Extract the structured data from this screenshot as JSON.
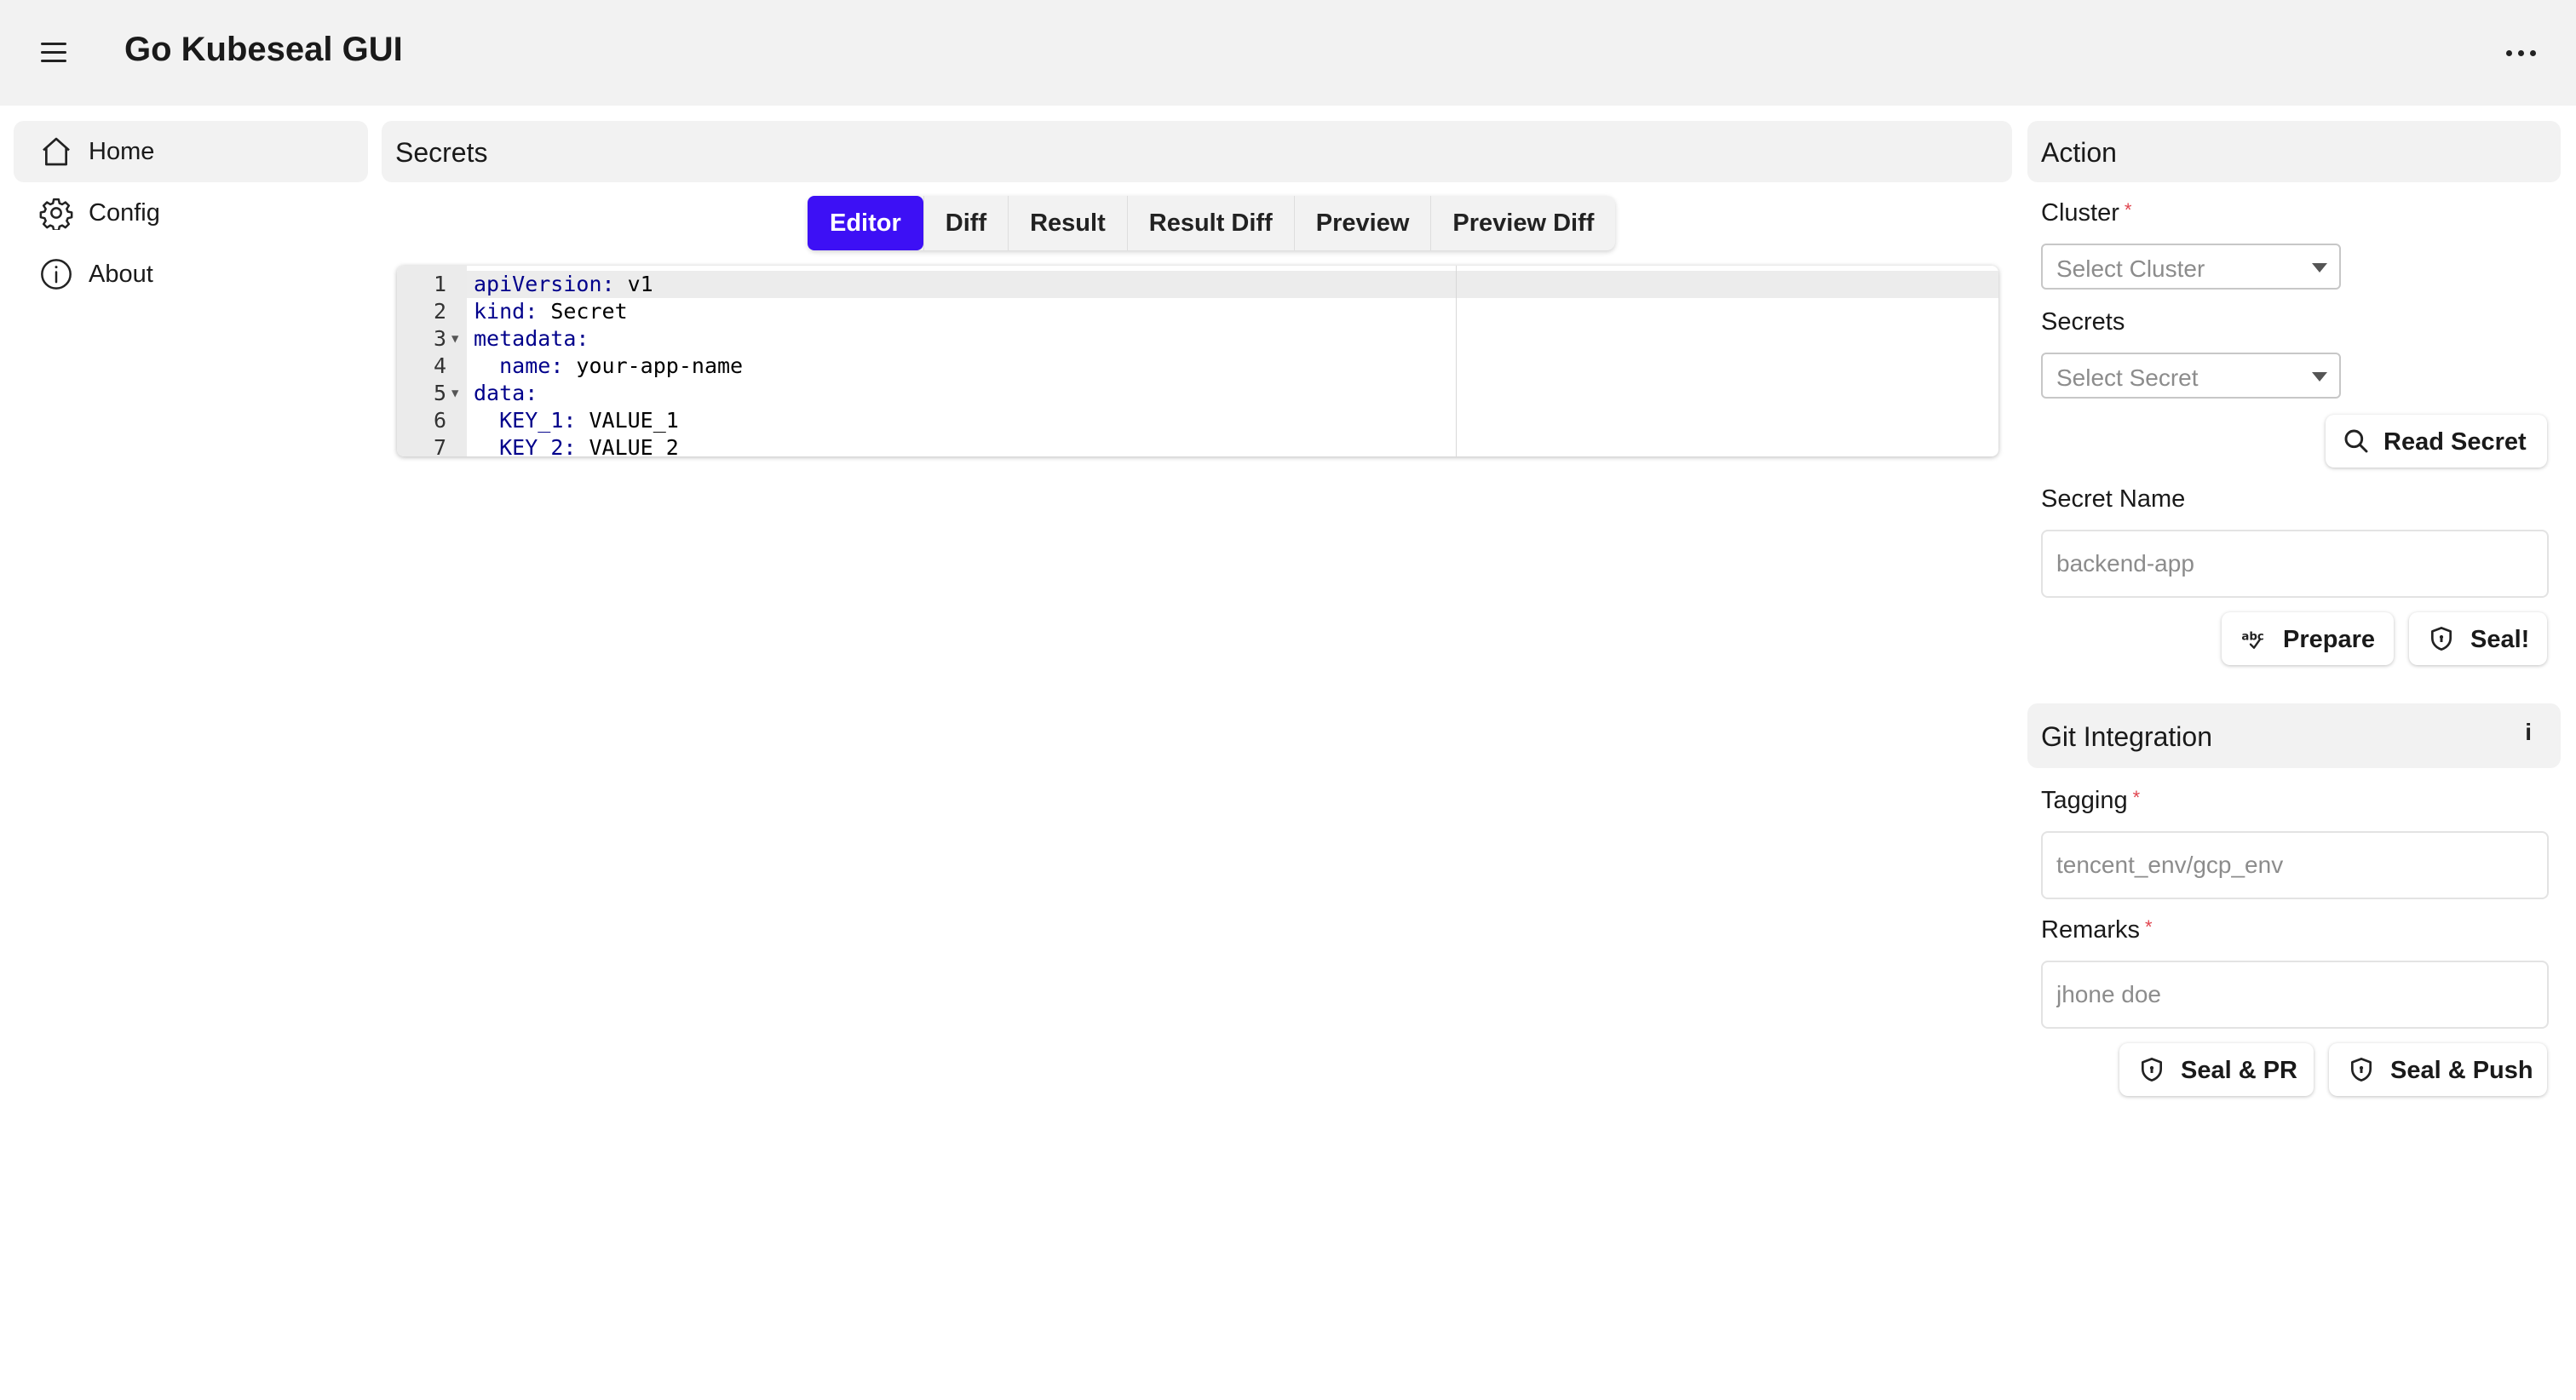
{
  "app": {
    "title": "Go Kubeseal GUI"
  },
  "sidebar": {
    "items": [
      {
        "label": "Home",
        "icon": "home-icon",
        "active": true
      },
      {
        "label": "Config",
        "icon": "gear-icon",
        "active": false
      },
      {
        "label": "About",
        "icon": "info-icon",
        "active": false
      }
    ]
  },
  "secrets": {
    "title": "Secrets",
    "tabs": [
      {
        "label": "Editor",
        "active": true
      },
      {
        "label": "Diff",
        "active": false
      },
      {
        "label": "Result",
        "active": false
      },
      {
        "label": "Result Diff",
        "active": false
      },
      {
        "label": "Preview",
        "active": false
      },
      {
        "label": "Preview Diff",
        "active": false
      }
    ],
    "editor": {
      "lines": [
        {
          "no": "1",
          "key": "apiVersion:",
          "value": " v1",
          "indent": "",
          "fold": false
        },
        {
          "no": "2",
          "key": "kind:",
          "value": " Secret",
          "indent": "",
          "fold": false
        },
        {
          "no": "3",
          "key": "metadata:",
          "value": "",
          "indent": "",
          "fold": true
        },
        {
          "no": "4",
          "key": "name:",
          "value": " your-app-name",
          "indent": "  ",
          "fold": false
        },
        {
          "no": "5",
          "key": "data:",
          "value": "",
          "indent": "",
          "fold": true
        },
        {
          "no": "6",
          "key": "KEY_1:",
          "value": " VALUE_1",
          "indent": "  ",
          "fold": false
        },
        {
          "no": "7",
          "key": "KEY_2:",
          "value": " VALUE_2",
          "indent": "  ",
          "fold": false
        }
      ]
    }
  },
  "action": {
    "title": "Action",
    "cluster": {
      "label": "Cluster",
      "required_mark": "*",
      "placeholder": "Select Cluster"
    },
    "secrets": {
      "label": "Secrets",
      "placeholder": "Select Secret"
    },
    "read_secret_label": "Read Secret",
    "secret_name": {
      "label": "Secret Name",
      "placeholder": "backend-app"
    },
    "prepare_label": "Prepare",
    "seal_label": "Seal!"
  },
  "git": {
    "title": "Git Integration",
    "info_label": "i",
    "tagging": {
      "label": "Tagging",
      "required_mark": "*",
      "placeholder": "tencent_env/gcp_env"
    },
    "remarks": {
      "label": "Remarks",
      "required_mark": "*",
      "placeholder": "jhone doe"
    },
    "seal_pr_label": "Seal & PR",
    "seal_push_label": "Seal & Push"
  }
}
